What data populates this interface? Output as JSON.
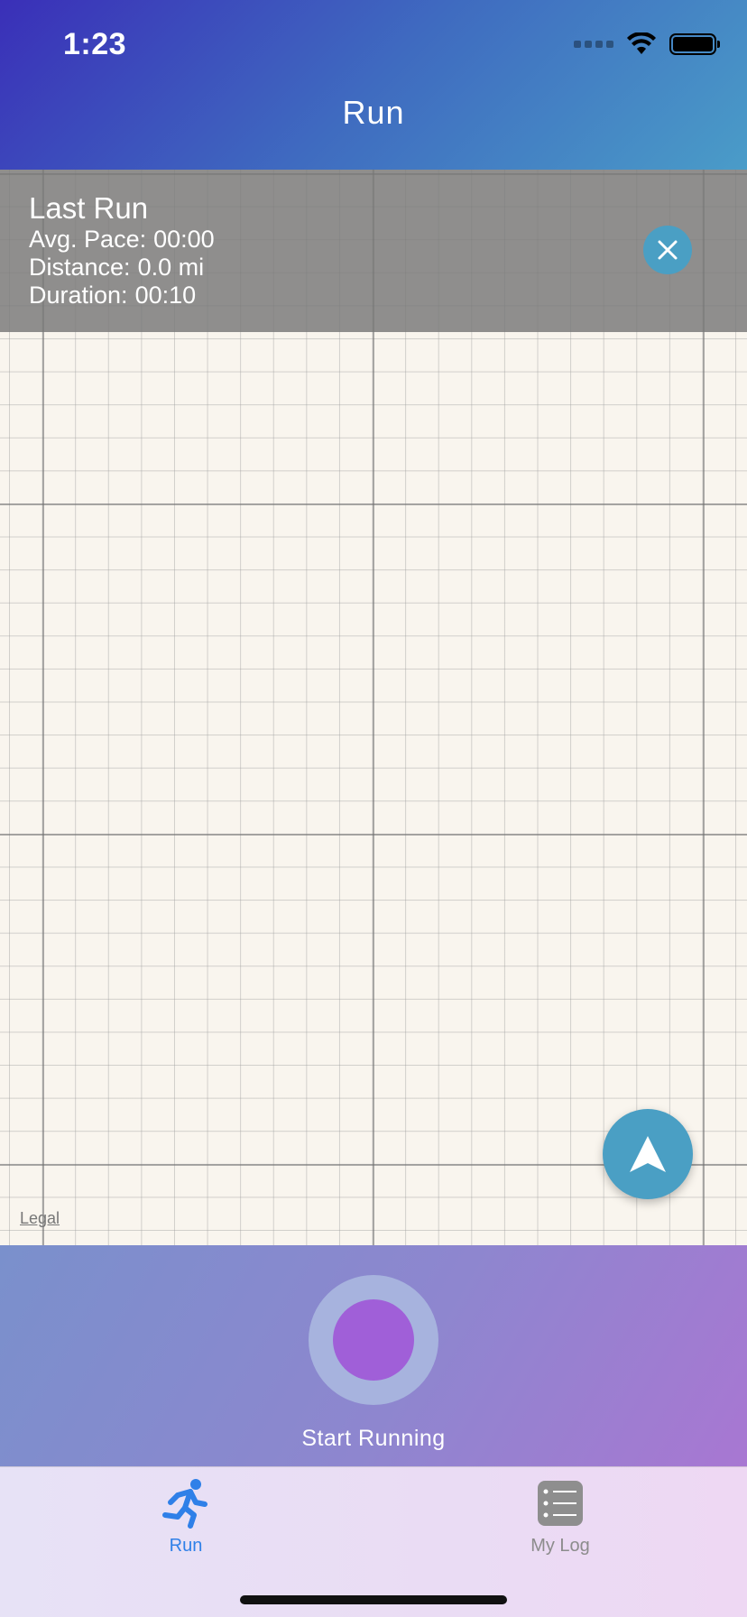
{
  "status_bar": {
    "time": "1:23",
    "icons": [
      "signal-icon",
      "wifi-icon",
      "battery-icon"
    ]
  },
  "header": {
    "title": "Run"
  },
  "last_run": {
    "title": "Last Run",
    "avg_pace_label": "Avg. Pace:",
    "avg_pace_value": "00:00",
    "distance_label": "Distance:",
    "distance_value": "0.0 mi",
    "duration_label": "Duration:",
    "duration_value": "00:10",
    "close_icon": "close-icon"
  },
  "map": {
    "legal_label": "Legal",
    "locate_icon": "location-arrow-icon"
  },
  "start_panel": {
    "label": "Start Running"
  },
  "tab_bar": {
    "tabs": [
      {
        "label": "Run",
        "icon": "running-person-icon",
        "selected": true
      },
      {
        "label": "My Log",
        "icon": "list-icon",
        "selected": false
      }
    ]
  },
  "colors": {
    "header_start": "#3a2fb8",
    "header_end": "#4a9cc8",
    "accent_blue": "#4a9fc4",
    "start_inner": "#a05fd8",
    "tab_selected": "#2f80e8",
    "tab_unselected": "#8c8c8c"
  }
}
